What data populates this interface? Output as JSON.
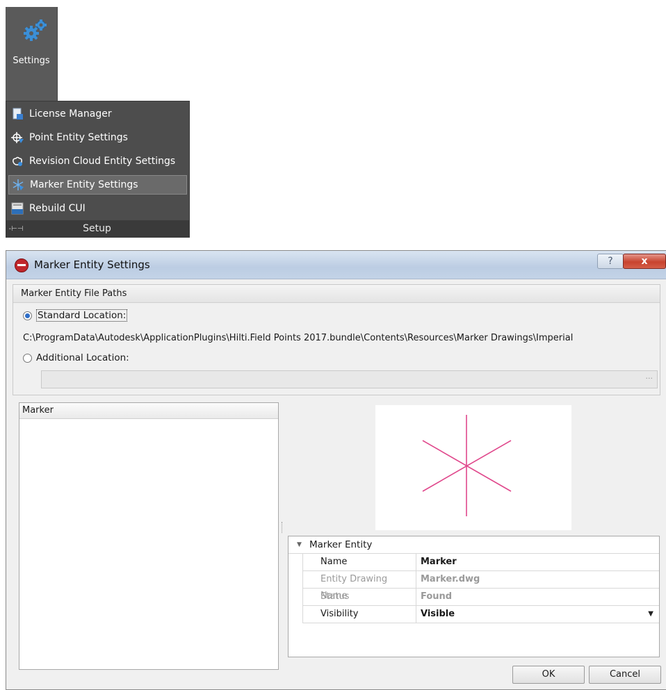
{
  "ribbon": {
    "settings_label": "Settings",
    "menu_items": [
      {
        "label": "License Manager",
        "icon": "document-icon"
      },
      {
        "label": "Point Entity Settings",
        "icon": "point-entity-icon"
      },
      {
        "label": "Revision Cloud Entity Settings",
        "icon": "revision-cloud-icon"
      },
      {
        "label": "Marker Entity Settings",
        "icon": "marker-icon",
        "selected": true
      },
      {
        "label": "Rebuild CUI",
        "icon": "cui-icon"
      }
    ],
    "panel_title": "Setup"
  },
  "dialog": {
    "title": "Marker Entity Settings",
    "help_glyph": "?",
    "close_glyph": "x",
    "file_paths": {
      "header": "Marker Entity File Paths",
      "standard_label": "Standard Location:",
      "standard_path": "C:\\ProgramData\\Autodesk\\ApplicationPlugins\\Hilti.Field Points 2017.bundle\\Contents\\Resources\\Marker Drawings\\Imperial",
      "additional_label": "Additional Location:",
      "additional_value": "",
      "browse_glyph": "···",
      "selected": "standard"
    },
    "marker_list": {
      "column_header": "Marker",
      "items": []
    },
    "properties": {
      "category": "Marker Entity",
      "rows": [
        {
          "name": "Name",
          "value": "Marker",
          "enabled": true
        },
        {
          "name": "Entity Drawing Name",
          "value": "Marker.dwg",
          "enabled": false
        },
        {
          "name": "Status",
          "value": "Found",
          "enabled": false
        },
        {
          "name": "Visibility",
          "value": "Visible",
          "enabled": true,
          "dropdown": true
        }
      ]
    },
    "preview_color": "#e0488c",
    "buttons": {
      "ok": "OK",
      "cancel": "Cancel"
    }
  }
}
